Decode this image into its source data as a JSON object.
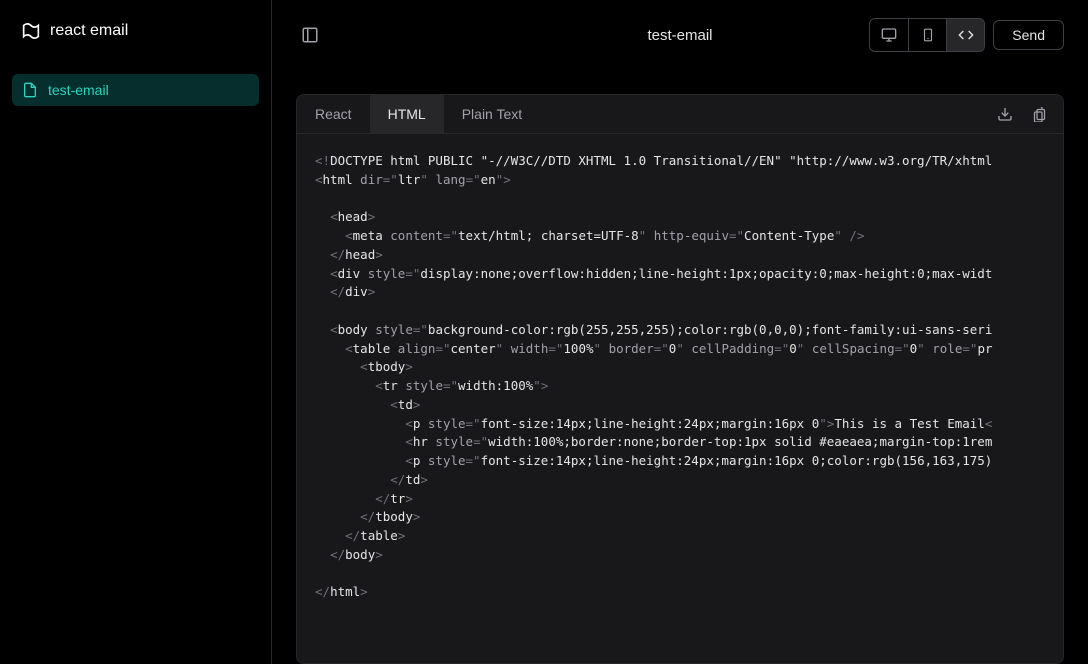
{
  "brand": "react email",
  "sidebar": {
    "items": [
      {
        "name": "test-email"
      }
    ]
  },
  "header": {
    "title": "test-email",
    "send_label": "Send"
  },
  "views": {
    "desktop": "desktop-icon",
    "mobile": "mobile-icon",
    "code": "code-icon"
  },
  "tabs": {
    "react": "React",
    "html": "HTML",
    "plain": "Plain Text"
  },
  "code": {
    "l1a": "<!",
    "l1b": "DOCTYPE html PUBLIC \"-//W3C//DTD XHTML 1.0 Transitional//EN\" \"http://www.w3.org/TR/xhtml",
    "l2_open": "<",
    "l2_tag": "html",
    "l2_a1": " dir",
    "l2_eq": "=\"",
    "l2_v1": "ltr",
    "l2_q": "\"",
    "l2_a2": " lang",
    "l2_v2": "en",
    "l2_close": ">",
    "head_open": "<",
    "head": "head",
    "gt": ">",
    "meta": "meta",
    "meta_content_k": " content",
    "meta_content_v": "text/html; charset=UTF-8",
    "meta_he_k": " http-equiv",
    "meta_he_v": "Content-Type",
    "selfclose": " />",
    "headc_open": "</",
    "div": "div",
    "div_style_k": " style",
    "div_style_v": "display:none;overflow:hidden;line-height:1px;opacity:0;max-height:0;max-widt",
    "body": "body",
    "body_style_v": "background-color:rgb(255,255,255);color:rgb(0,0,0);font-family:ui-sans-seri",
    "table": "table",
    "table_align_k": " align",
    "table_align_v": "center",
    "table_width_k": " width",
    "table_width_v": "100%",
    "table_border_k": " border",
    "table_border_v": "0",
    "table_cp_k": " cellPadding",
    "table_cp_v": "0",
    "table_cs_k": " cellSpacing",
    "table_cs_v": "0",
    "table_role_k": " role",
    "table_role_v": "pr",
    "tbody": "tbody",
    "tr": "tr",
    "tr_style_v": "width:100%",
    "td": "td",
    "p": "p",
    "p_style_v": "font-size:14px;line-height:24px;margin:16px 0",
    "p_text": "This is a Test Email",
    "hr": "hr",
    "hr_style_v": "width:100%;border:none;border-top:1px solid #eaeaea;margin-top:1rem",
    "p2_style_v": "font-size:14px;line-height:24px;margin:16px 0;color:rgb(156,163,175)"
  }
}
